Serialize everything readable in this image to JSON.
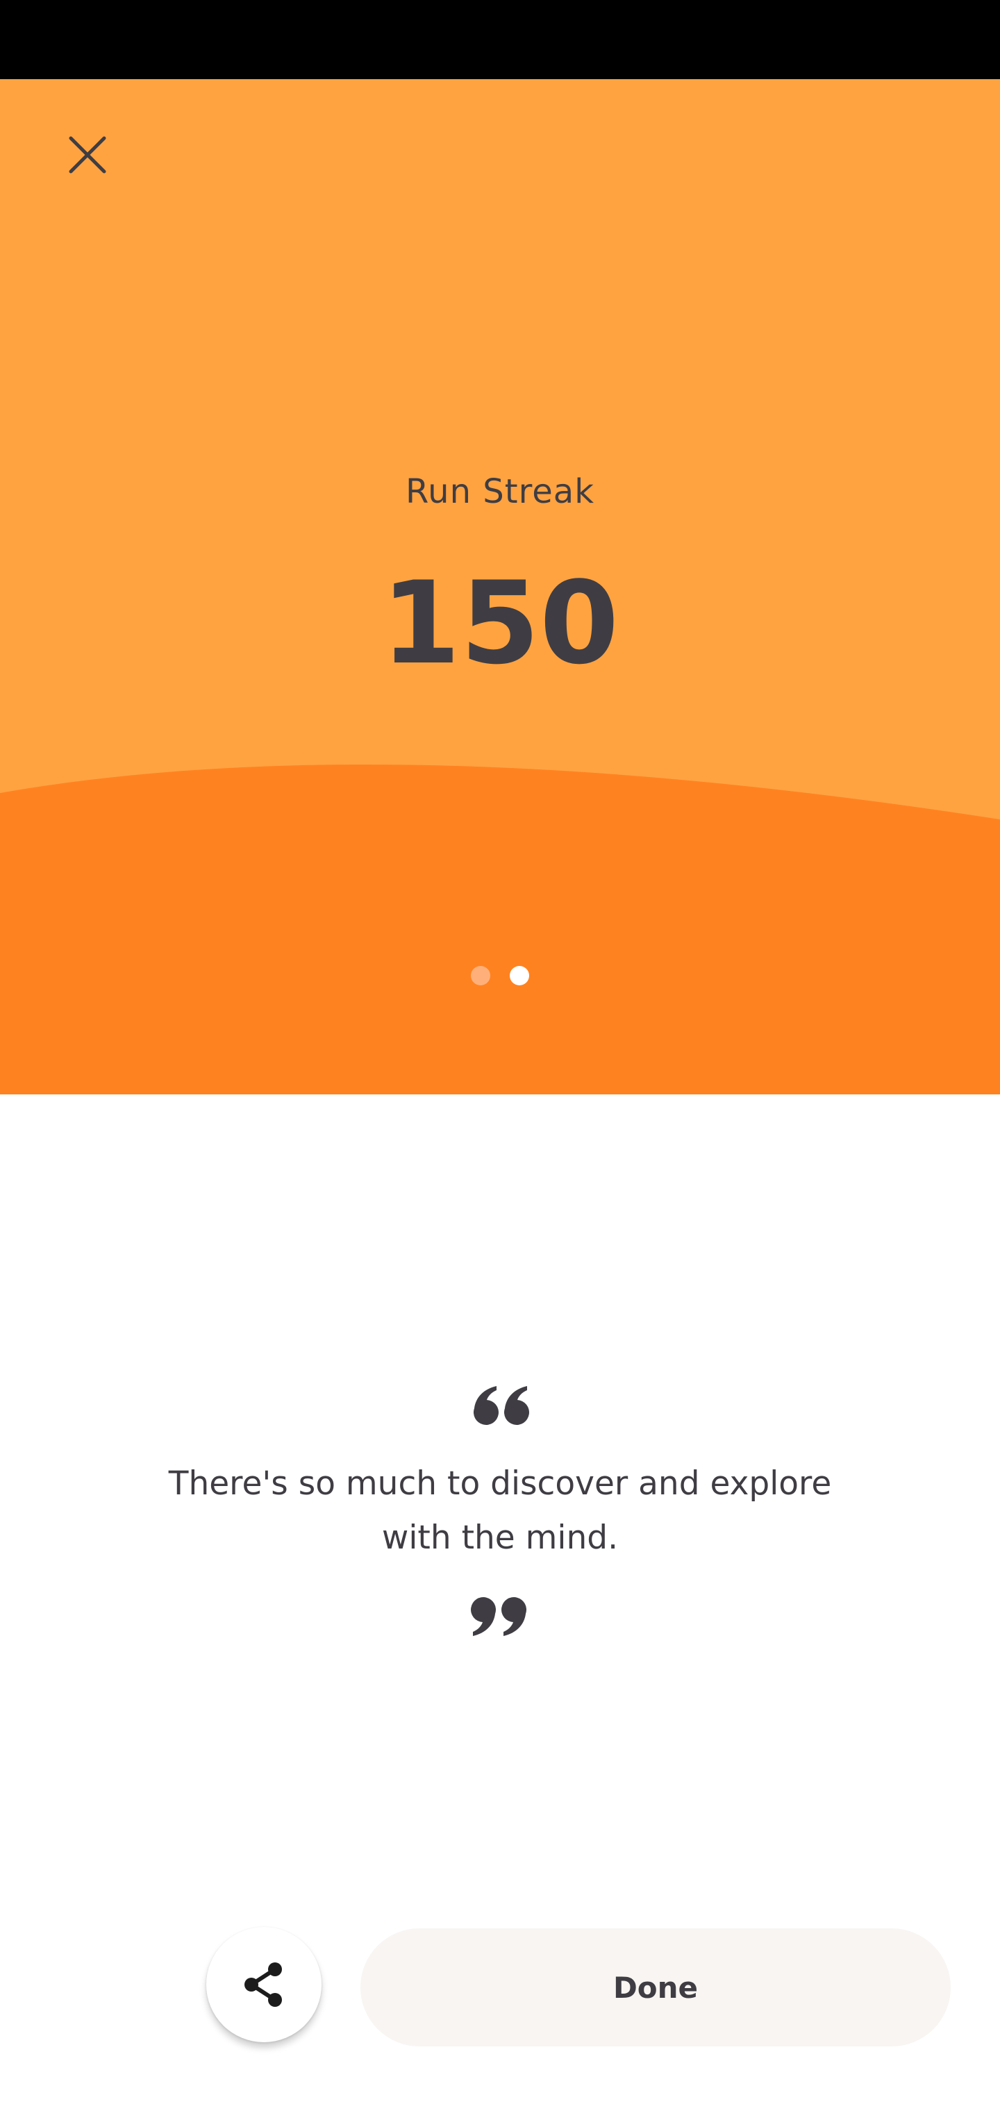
{
  "colors": {
    "hero_light": "#FFA341",
    "hero_dark": "#FF8220",
    "text_dark": "#3f3d43",
    "button_bg": "#F8F5F2"
  },
  "hero": {
    "close_icon": "close-icon",
    "label": "Run Streak",
    "value": "150",
    "pager": {
      "count": 2,
      "active_index": 1
    }
  },
  "quote": {
    "open_icon": "quote-open-icon",
    "text": "There's so much to discover and explore with the mind.",
    "close_icon": "quote-close-icon"
  },
  "actions": {
    "share_icon": "share-icon",
    "done_label": "Done"
  }
}
